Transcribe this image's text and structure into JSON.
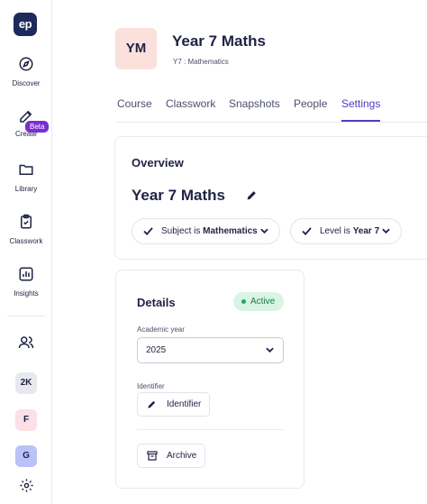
{
  "logo": {
    "text": "ep"
  },
  "sidebar": {
    "items": [
      {
        "label": "Discover",
        "icon": "compass-icon"
      },
      {
        "label": "Create",
        "icon": "edit-icon",
        "badge": "Beta"
      },
      {
        "label": "Library",
        "icon": "folder-icon"
      },
      {
        "label": "Classwork",
        "icon": "clipboard-icon"
      },
      {
        "label": "Insights",
        "icon": "chart-icon"
      }
    ],
    "people_icon": "users-icon",
    "avatars": [
      {
        "text": "2K",
        "color": "#e8e9ef"
      },
      {
        "text": "F",
        "color": "#fbe0e6"
      },
      {
        "text": "G",
        "color": "#b9c3f7"
      }
    ],
    "settings_icon": "gear-icon"
  },
  "header": {
    "initials": "YM",
    "initials_bg": "#fbe0dc",
    "title": "Year 7 Maths",
    "subtitle": "Y7 : Mathematics"
  },
  "tabs": [
    {
      "label": "Course",
      "active": false
    },
    {
      "label": "Classwork",
      "active": false
    },
    {
      "label": "Snapshots",
      "active": false
    },
    {
      "label": "People",
      "active": false
    },
    {
      "label": "Settings",
      "active": true
    }
  ],
  "overview": {
    "heading": "Overview",
    "name": "Year 7 Maths",
    "subject": {
      "prefix": "Subject is",
      "value": "Mathematics"
    },
    "level": {
      "prefix": "Level is",
      "value": "Year 7"
    }
  },
  "details": {
    "heading": "Details",
    "status": "Active",
    "academic_year_label": "Academic year",
    "academic_year_value": "2025",
    "identifier_label": "Identifier",
    "identifier_button": "Identifier",
    "archive_button": "Archive"
  },
  "colors": {
    "accent": "#4a3fc0",
    "brand": "#1f2a5c",
    "beta": "#7a2fd0",
    "active_green": "#22a763"
  }
}
